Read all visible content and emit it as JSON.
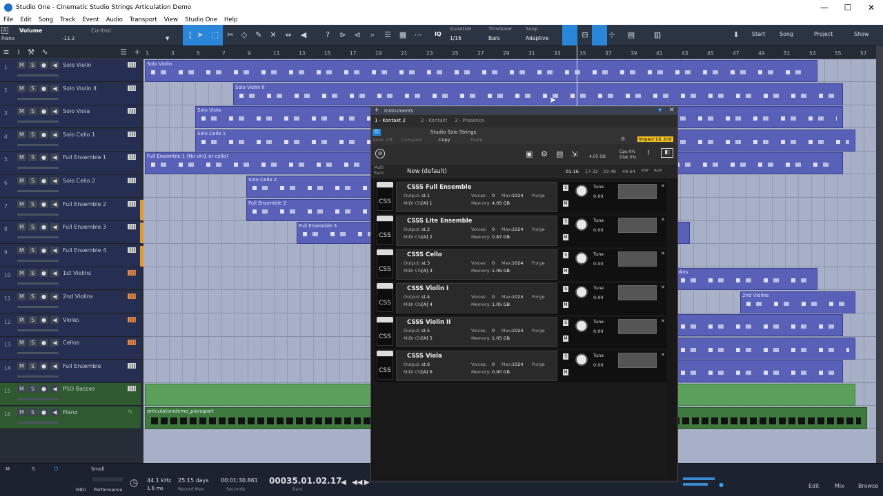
{
  "window": {
    "title": "Studio One - Cinematic Studio Strings Articulation Demo",
    "controls": [
      "—",
      "☐",
      "✕"
    ]
  },
  "menu": [
    "File",
    "Edit",
    "Song",
    "Track",
    "Event",
    "Audio",
    "Transport",
    "View",
    "Studio One",
    "Help"
  ],
  "toolbar": {
    "track_label": "Volume",
    "control_label": "Control",
    "instrument": "Piano",
    "value": "-11.3",
    "quantize_label": "Quantize",
    "quantize_value": "1/16",
    "timebase_label": "Timebase",
    "timebase_value": "Bars",
    "snap_label": "Snap",
    "snap_value": "Adaptive",
    "iq": "IQ",
    "nav": {
      "start": "Start",
      "song": "Song",
      "project": "Project",
      "show": "Show"
    }
  },
  "ruler": [
    "1",
    "3",
    "5",
    "7",
    "9",
    "11",
    "13",
    "15",
    "17",
    "19",
    "21",
    "23",
    "25",
    "27",
    "29",
    "31",
    "33",
    "35",
    "37",
    "39",
    "41",
    "43",
    "45",
    "47",
    "49",
    "51",
    "53",
    "55",
    "57"
  ],
  "tracks": [
    {
      "n": "1",
      "name": "Solo Violin",
      "icon": "kbd"
    },
    {
      "n": "2",
      "name": "Solo Violin II",
      "icon": "kbd"
    },
    {
      "n": "3",
      "name": "Solo Viola",
      "icon": "kbd"
    },
    {
      "n": "4",
      "name": "Solo Cello 1",
      "icon": "kbd"
    },
    {
      "n": "5",
      "name": "Full Ensemble 1",
      "icon": "kbd"
    },
    {
      "n": "6",
      "name": "Solo Cello 2",
      "icon": "kbd"
    },
    {
      "n": "7",
      "name": "Full Ensemble 2",
      "icon": "kbd"
    },
    {
      "n": "8",
      "name": "Full Ensemble 3",
      "icon": "kbd"
    },
    {
      "n": "9",
      "name": "Full Ensemble 4",
      "icon": "kbd"
    },
    {
      "n": "10",
      "name": "1st Violins",
      "icon": "kbd-orange"
    },
    {
      "n": "11",
      "name": "2nd Violins",
      "icon": "kbd-orange"
    },
    {
      "n": "12",
      "name": "Violas",
      "icon": "kbd-orange"
    },
    {
      "n": "13",
      "name": "Cellos",
      "icon": "kbd-orange"
    },
    {
      "n": "14",
      "name": "Full Ensemble",
      "icon": "kbd"
    },
    {
      "n": "15",
      "name": "PSO Basses",
      "icon": "kbd"
    },
    {
      "n": "16",
      "name": "Piano",
      "icon": "wave"
    }
  ],
  "track_buttons": {
    "m": "M",
    "s": "S",
    "r": "●",
    "mon": "◀"
  },
  "clips": {
    "c1": "Solo Violin",
    "c2": "Solo Violin II",
    "c3": "Solo Viola",
    "c4": "Solo Cello 1",
    "c5": "Full Ensemble 1 (No vln1 or cello)",
    "c6": "Solo Cello 2",
    "c7": "Full Ensemble 2",
    "c8": "Full Ensemble 3",
    "c10": "olins",
    "c11": "2nd Violins",
    "c16": "articulationdemo_pianopart"
  },
  "instruments": {
    "title": "Instruments",
    "tabs": [
      "1 - Kontakt 2",
      "2 - Kontakt",
      "3 - Presence"
    ],
    "preset": "Studio Solo Strings",
    "auto": "Auto: Off",
    "compare": "Compare",
    "copy": "Copy",
    "paste": "Paste",
    "badge": "Impact LX..trol",
    "rack": {
      "label_top": "Multi",
      "label_bottom": "Rack",
      "name": "New (default)",
      "pages": [
        "01-16",
        "17-32",
        "33-48",
        "49-64"
      ],
      "aux": "KSP",
      "aux2": "AUX"
    },
    "head": {
      "mem": "4.05 GB",
      "cpu": "Cpu  0%",
      "disk": "Disk  0%"
    },
    "rows": [
      {
        "name": "CSSS Full Ensemble",
        "out": "st.1",
        "voices": "0",
        "max": "1024",
        "midi": "[A]  1",
        "mem": "4.05 GB"
      },
      {
        "name": "CSSS Lite Ensemble",
        "out": "st.2",
        "voices": "0",
        "max": "1024",
        "midi": "[A]  2",
        "mem": "0.87 GB"
      },
      {
        "name": "CSSS Cello",
        "out": "st.3",
        "voices": "0",
        "max": "1024",
        "midi": "[A]  3",
        "mem": "1.06 GB"
      },
      {
        "name": "CSSS Violin I",
        "out": "st.4",
        "voices": "0",
        "max": "1024",
        "midi": "[A]  4",
        "mem": "1.05 GB"
      },
      {
        "name": "CSSS Violin II",
        "out": "st.5",
        "voices": "0",
        "max": "1024",
        "midi": "[A]  5",
        "mem": "1.05 GB"
      },
      {
        "name": "CSSS Viola",
        "out": "st.6",
        "voices": "0",
        "max": "1024",
        "midi": "[A]  6",
        "mem": "0.90 GB"
      }
    ],
    "row_labels": {
      "output": "Output:",
      "voices": "Voices:",
      "max": "Max:",
      "midi": "MIDI Ch:",
      "memory": "Memory:",
      "purge": "Purge",
      "tune": "Tune",
      "tune_val": "0.00",
      "css": "CSS",
      "s": "S",
      "m": "M"
    }
  },
  "transport": {
    "midi": "MIDI",
    "performance": "Performance",
    "rate": "44.1 kHz",
    "latency": "1.6 ms",
    "record_days": "25:15 days",
    "record_max": "Record Max",
    "time": "00:01:30.861",
    "seconds": "Seconds",
    "bars_value": "00035.01.02.17",
    "bars": "Bars"
  },
  "footer": {
    "m": "M",
    "s": "S",
    "small": "Small",
    "edit": "Edit",
    "mix": "Mix",
    "browse": "Browse"
  }
}
